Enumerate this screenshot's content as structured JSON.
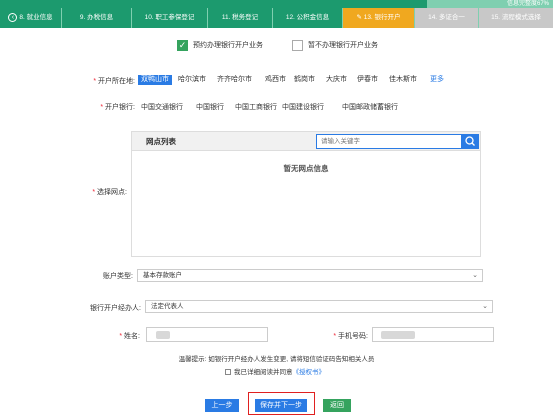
{
  "progress_text": "信息完整度67%",
  "steps": [
    {
      "label": "8. 就业信息",
      "state": "done",
      "back": true
    },
    {
      "label": "9. 办税信息",
      "state": "done"
    },
    {
      "label": "10. 职工参保登记",
      "state": "done"
    },
    {
      "label": "11. 税务登记",
      "state": "done"
    },
    {
      "label": "12. 公积金信息",
      "state": "done"
    },
    {
      "label": "13. 银行开户",
      "state": "active",
      "edit_icon": true
    },
    {
      "label": "14. 多证合一",
      "state": "todo"
    },
    {
      "label": "15. 流程模式选择",
      "state": "todo"
    }
  ],
  "agree": {
    "yes_label": "预约办理银行开户业务",
    "no_label": "暂不办理银行开户业务"
  },
  "city": {
    "label": "开户所在地:",
    "options": [
      "双鸭山市",
      "哈尔滨市",
      "齐齐哈尔市",
      "鸡西市",
      "鹤岗市",
      "大庆市",
      "伊春市",
      "佳木斯市"
    ],
    "selected": "双鸭山市",
    "more": "更多"
  },
  "bank": {
    "label": "开户银行:",
    "options": [
      "中国交通银行",
      "中国银行",
      "中国工商银行",
      "中国建设银行",
      "中国邮政储蓄银行"
    ]
  },
  "outlet": {
    "label": "选择网点:",
    "list_title": "网点列表",
    "search_placeholder": "请输入关键字",
    "empty_text": "暂无网点信息"
  },
  "account_type": {
    "label": "账户类型:",
    "value": "基本存款账户"
  },
  "handler": {
    "label": "银行开户经办人:",
    "value": "法定代表人"
  },
  "name": {
    "label": "姓名:"
  },
  "phone": {
    "label": "手机号码:"
  },
  "notice": "温馨提示: 如银行开户经办人发生变更, 请将短信验证码告知相关人员",
  "agreement": {
    "prefix": "我已详细阅读并同意",
    "link": "《授权书》"
  },
  "buttons": {
    "prev": "上一步",
    "save": "保存并下一步",
    "return": "返回"
  },
  "colors": {
    "theme_green": "#1c9a6e",
    "active_step": "#f0a81f",
    "primary_blue": "#2a7be4",
    "highlight_red": "#e02020"
  }
}
